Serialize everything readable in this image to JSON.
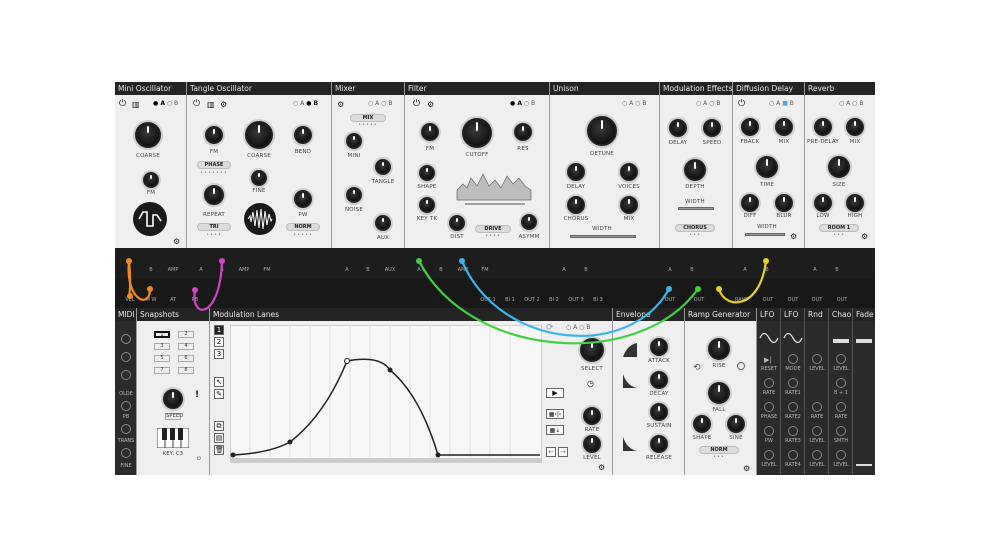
{
  "modules_top": {
    "mini_oscillator": {
      "title": "Mini Oscillator",
      "sel_a": "A",
      "sel_b": "B",
      "coarse": "COARSE",
      "fm": "FM"
    },
    "tangle_oscillator": {
      "title": "Tangle Oscillator",
      "sel_a": "A",
      "sel_b": "B",
      "fm": "FM",
      "coarse": "COARSE",
      "bend": "BEND",
      "phase": "PHASE",
      "fine": "FINE",
      "repeat": "REPEAT",
      "pw": "PW",
      "tri": "TRI",
      "norm": "NORM"
    },
    "mixer": {
      "title": "Mixer",
      "sel_a": "A",
      "sel_b": "B",
      "mix": "MIX",
      "mini": "MINI",
      "tangle": "TANGLE",
      "noise": "NOISE",
      "aux": "AUX"
    },
    "filter": {
      "title": "Filter",
      "sel_a": "A",
      "sel_b": "B",
      "fm": "FM",
      "cutoff": "CUTOFF",
      "res": "RES",
      "shape": "SHAPE",
      "key_tk": "KEY TK",
      "dist": "DIST",
      "drive": "DRIVE",
      "asymm": "ASYMM"
    },
    "unison": {
      "title": "Unison",
      "sel_a": "A",
      "sel_b": "B",
      "detune": "DETUNE",
      "delay": "DELAY",
      "voices": "VOICES",
      "chorus": "CHORUS",
      "mix": "MIX",
      "width": "WIDTH"
    },
    "modulation_effects": {
      "title": "Modulation Effects",
      "sel_a": "A",
      "sel_b": "B",
      "delay": "DELAY",
      "speed": "SPEED",
      "depth": "DEPTH",
      "width": "WIDTH",
      "chorus": "CHORUS"
    },
    "diffusion_delay": {
      "title": "Diffusion Delay",
      "sel_a": "A",
      "sel_b": "B",
      "fback": "FBACK",
      "mix": "MIX",
      "time": "TIME",
      "diff": "DIFF",
      "blur": "BLUR",
      "width": "WIDTH"
    },
    "reverb": {
      "title": "Reverb",
      "sel_a": "A",
      "sel_b": "B",
      "pre_delay": "PRE-DELAY",
      "mix": "MIX",
      "size": "SIZE",
      "low": "LOW",
      "high": "HIGH",
      "room": "ROOM 1"
    }
  },
  "strip1_jacks": [
    "B",
    "AMP",
    "A",
    "B",
    "AMP",
    "FM",
    "A",
    "B",
    "AUX",
    "A",
    "B",
    "AMP",
    "FM",
    "A",
    "B",
    "A",
    "B",
    "A",
    "B",
    "A",
    "B"
  ],
  "strip2_jacks": [
    "VEL",
    "M W",
    "AT",
    "PB",
    "OUT 1",
    "BI 1",
    "OUT 2",
    "BI 2",
    "OUT 3",
    "BI 3",
    "OUT",
    "OUT",
    "RAMP",
    "OUT",
    "OUT",
    "OUT",
    "OUT"
  ],
  "modules_bottom": {
    "midi": {
      "title": "MIDI",
      "labels": [
        "OLDE",
        "PB",
        "TRANS",
        "FINE"
      ]
    },
    "snapshots": {
      "title": "Snapshots",
      "buttons": [
        "1",
        "2",
        "3",
        "4",
        "5",
        "6",
        "7",
        "8"
      ],
      "speed": "SPEED",
      "exclaim": "!",
      "key": "KEY: C3"
    },
    "modulation_lanes": {
      "title": "Modulation Lanes",
      "lanes": [
        "1",
        "2",
        "3"
      ],
      "select": "SELECT",
      "rate": "RATE",
      "level": "LEVEL",
      "sel_a": "A",
      "sel_b": "B"
    },
    "envelope": {
      "title": "Envelope",
      "attack": "ATTACK",
      "decay": "DECAY",
      "sustain": "SUSTAIN",
      "release": "RELEASE"
    },
    "ramp_generator": {
      "title": "Ramp Generator",
      "rise": "RISE",
      "fall": "FALL",
      "shape": "SHAPE",
      "sine": "SINE",
      "norm": "NORM"
    },
    "lfo1": {
      "title": "LFO",
      "labels": [
        "RESET",
        "RATE",
        "PHASE",
        "PW",
        "LEVEL"
      ]
    },
    "lfo2": {
      "title": "LFO",
      "labels": [
        "MODE",
        "RATE1",
        "RATE2",
        "RATE3",
        "RATE4"
      ]
    },
    "rnd": {
      "title": "Rnd",
      "labels": [
        "LEVEL",
        "RATE",
        "LEVEL",
        "LEVEL"
      ]
    },
    "chaos": {
      "title": "Chao",
      "labels": [
        "LEVEL",
        "B + 1",
        "RATE",
        "SMTH",
        "LEVEL"
      ]
    },
    "fade": {
      "title": "Fade"
    }
  },
  "colors": {
    "cable_orange": "#f08a1c",
    "cable_magenta": "#d640c8",
    "cable_green": "#3fd23f",
    "cable_cyan": "#3ab7ea",
    "cable_yellow": "#e6d21a"
  }
}
